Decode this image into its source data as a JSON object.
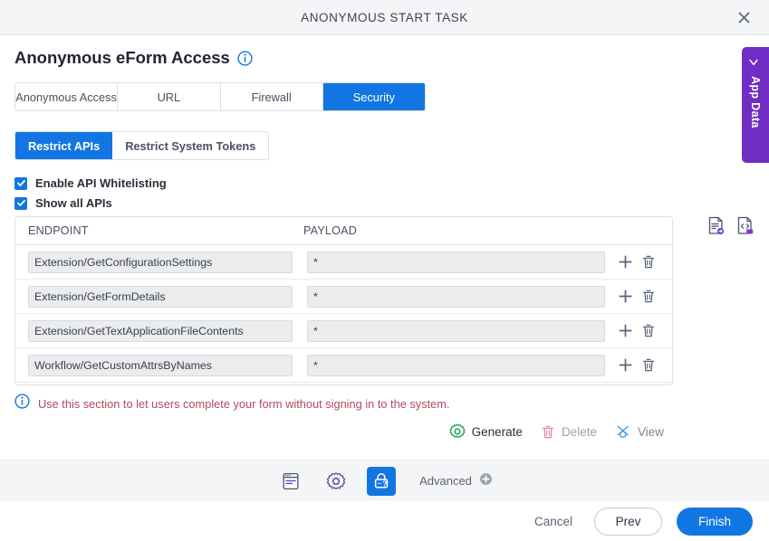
{
  "window": {
    "title": "ANONYMOUS START TASK",
    "close_icon": "close-icon"
  },
  "page": {
    "title": "Anonymous eForm Access",
    "info_icon": "info-icon"
  },
  "tabs": [
    {
      "label": "Anonymous Access",
      "active": false
    },
    {
      "label": "URL",
      "active": false
    },
    {
      "label": "Firewall",
      "active": false
    },
    {
      "label": "Security",
      "active": true
    }
  ],
  "subtabs": [
    {
      "label": "Restrict APIs",
      "active": true
    },
    {
      "label": "Restrict System Tokens",
      "active": false
    }
  ],
  "checkboxes": [
    {
      "label": "Enable API Whitelisting",
      "checked": true
    },
    {
      "label": "Show all APIs",
      "checked": true
    }
  ],
  "table_tools": [
    {
      "name": "import-apis-icon"
    },
    {
      "name": "export-apis-icon"
    }
  ],
  "table": {
    "columns": [
      "ENDPOINT",
      "PAYLOAD"
    ],
    "rows": [
      {
        "endpoint": "Extension/GetConfigurationSettings",
        "payload": "*"
      },
      {
        "endpoint": "Extension/GetFormDetails",
        "payload": "*"
      },
      {
        "endpoint": "Extension/GetTextApplicationFileContents",
        "payload": "*"
      },
      {
        "endpoint": "Workflow/GetCustomAttrsByNames",
        "payload": "*"
      },
      {
        "endpoint": "",
        "payload": ""
      }
    ],
    "row_add_icon": "plus-icon",
    "row_delete_icon": "trash-icon"
  },
  "banner": {
    "icon": "info-icon",
    "text": "Use this section to let users complete your form without signing in to the system."
  },
  "actions": [
    {
      "label": "Generate",
      "icon": "gear-icon",
      "state": "enabled"
    },
    {
      "label": "Delete",
      "icon": "trash-icon",
      "state": "disabled"
    },
    {
      "label": "View",
      "icon": "view-icon",
      "state": "disabled"
    }
  ],
  "bottom_toolbar": {
    "buttons": [
      {
        "name": "form-designer-icon",
        "active": false
      },
      {
        "name": "settings-gear-icon",
        "active": false
      },
      {
        "name": "anonymous-access-lock-icon",
        "active": true
      }
    ],
    "advanced_label": "Advanced",
    "advanced_icon": "plus-circle-icon"
  },
  "footer": {
    "cancel_label": "Cancel",
    "prev_label": "Prev",
    "finish_label": "Finish"
  },
  "app_data": {
    "label": "App Data",
    "chevron_icon": "chevron-left-icon"
  },
  "colors": {
    "accent_blue": "#1276e2",
    "purple": "#6f2dc4",
    "banner_red": "#b14a5d",
    "green": "#14a04a",
    "titlebar_bg": "#f4f5f7"
  }
}
